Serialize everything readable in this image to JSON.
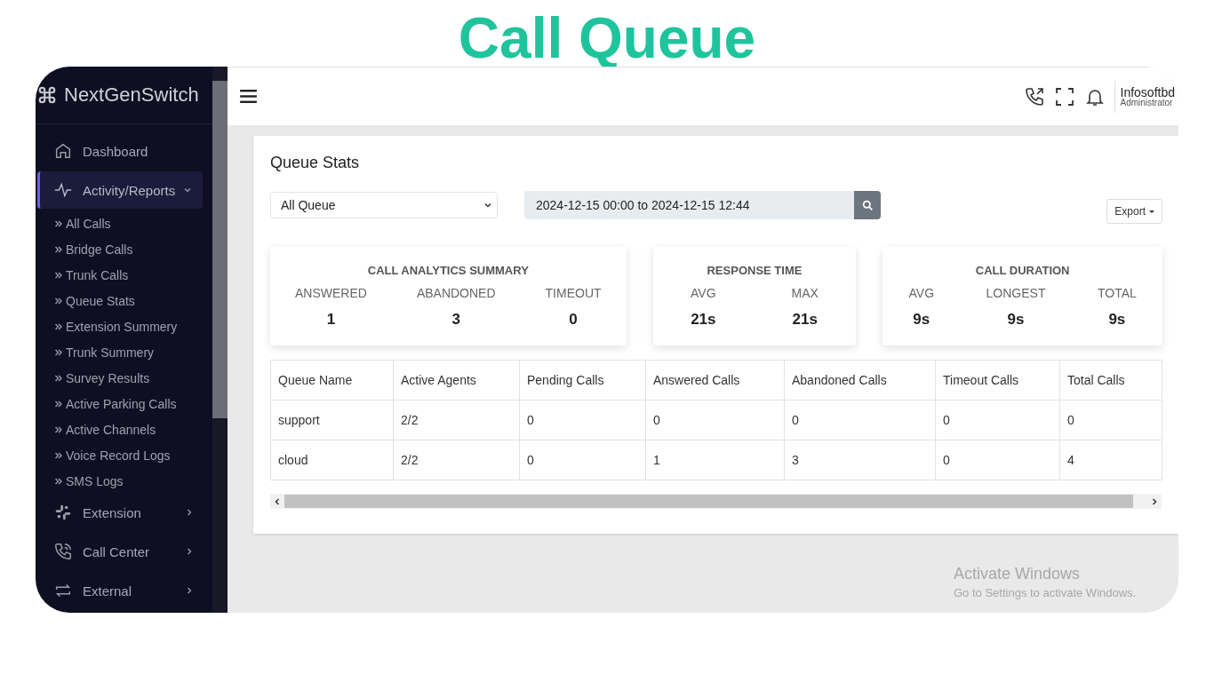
{
  "slide_title": "Call Queue",
  "sidebar": {
    "brand": "NextGenSwitch",
    "items": [
      {
        "kind": "home",
        "label": "Dashboard",
        "selected": false
      },
      {
        "kind": "activity",
        "label": "Activity/Reports",
        "selected": true,
        "expanded": true,
        "children": [
          {
            "label": "All Calls",
            "selected": false
          },
          {
            "label": "Bridge Calls",
            "selected": false
          },
          {
            "label": "Trunk Calls",
            "selected": false
          },
          {
            "label": "Queue Stats",
            "selected": false
          },
          {
            "label": "Extension Summery",
            "selected": false
          },
          {
            "label": "Trunk Summery",
            "selected": false
          },
          {
            "label": "Survey Results",
            "selected": false
          },
          {
            "label": "Active Parking Calls",
            "selected": false
          },
          {
            "label": "Active Channels",
            "selected": false
          },
          {
            "label": "Voice Record Logs",
            "selected": false
          },
          {
            "label": "SMS Logs",
            "selected": false
          }
        ]
      },
      {
        "kind": "extension",
        "label": "Extension",
        "selected": false,
        "expanded": false
      },
      {
        "kind": "phone",
        "label": "Call Center",
        "selected": false,
        "expanded": false
      },
      {
        "kind": "exchange",
        "label": "External",
        "selected": false,
        "expanded": false
      }
    ]
  },
  "header": {
    "user_name": "Infosoftbd",
    "user_role": "Administrator"
  },
  "page": {
    "title": "Queue Stats",
    "queue_select": "All Queue",
    "date_range": "2024-12-15 00:00 to 2024-12-15 12:44",
    "export_button": "Export"
  },
  "summaries": [
    {
      "title": "CALL ANALYTICS SUMMARY",
      "stats": [
        {
          "label": "ANSWERED",
          "value": "1"
        },
        {
          "label": "ABANDONED",
          "value": "3"
        },
        {
          "label": "TIMEOUT",
          "value": "0"
        }
      ]
    },
    {
      "title": "RESPONSE TIME",
      "stats": [
        {
          "label": "AVG",
          "value": "21s"
        },
        {
          "label": "MAX",
          "value": "21s"
        }
      ]
    },
    {
      "title": "CALL DURATION",
      "stats": [
        {
          "label": "AVG",
          "value": "9s"
        },
        {
          "label": "LONGEST",
          "value": "9s"
        },
        {
          "label": "TOTAL",
          "value": "9s"
        }
      ]
    }
  ],
  "table": {
    "columns": [
      "Queue Name",
      "Active Agents",
      "Pending Calls",
      "Answered Calls",
      "Abandoned Calls",
      "Timeout Calls",
      "Total Calls"
    ],
    "rows": [
      [
        "support",
        "2/2",
        "0",
        "0",
        "0",
        "0",
        "0"
      ],
      [
        "cloud",
        "2/2",
        "0",
        "1",
        "3",
        "0",
        "4"
      ]
    ]
  },
  "activation_notice": {
    "title": "Activate Windows",
    "subtitle": "Go to Settings to activate Windows."
  }
}
